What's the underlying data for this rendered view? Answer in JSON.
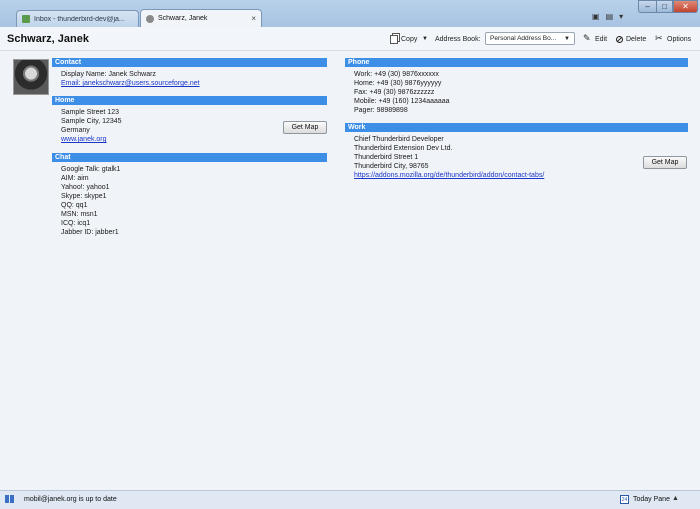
{
  "tabs": [
    {
      "label": "Inbox - thunderbird-dev@ja...",
      "close": ""
    },
    {
      "label": "Schwarz, Janek",
      "close": "×"
    }
  ],
  "window": {
    "minimize": "–",
    "maximize": "□",
    "close": "✕"
  },
  "header": {
    "title": "Schwarz, Janek",
    "copy_label": "Copy",
    "copy_dropdown": "▼",
    "address_book_label": "Address Book:",
    "address_book_value": "Personal Address Bo...",
    "address_book_arrow": "▼",
    "edit_label": "Edit",
    "delete_label": "Delete",
    "options_label": "Options"
  },
  "contact": {
    "heading": "Contact",
    "display_name": "Display Name: Janek Schwarz",
    "email": "Email: janekschwarz@users.sourceforge.net"
  },
  "home": {
    "heading": "Home",
    "street": "Sample Street 123",
    "city": "Sample City, 12345",
    "country": "Germany",
    "website": "www.janek.org",
    "map_button": "Get Map"
  },
  "chat": {
    "heading": "Chat",
    "items": [
      "Google Talk: gtalk1",
      "AIM: aim",
      "Yahoo!: yahoo1",
      "Skype: skype1",
      "QQ: qq1",
      "MSN: msn1",
      "ICQ: icq1",
      "Jabber ID: jabber1"
    ]
  },
  "phone": {
    "heading": "Phone",
    "items": [
      "Work: +49 (30) 9876xxxxxx",
      "Home: +49 (30) 9876yyyyyy",
      "Fax: +49 (30) 9876zzzzzz",
      "Mobile: +49 (160) 1234aaaaaa",
      "Pager: 98989898"
    ]
  },
  "work": {
    "heading": "Work",
    "job_title": "Chief Thunderbird Developer",
    "company": "Thunderbird Extension Dev Ltd.",
    "street": "Thunderbird Street 1",
    "city": "Thunderbird City, 98765",
    "website": "https://addons.mozilla.org/de/thunderbird/addon/contact-tabs/",
    "map_button": "Get Map"
  },
  "status": {
    "text": "mobil@janek.org is up to date",
    "today_pane": "Today Pane",
    "today_day": "24",
    "today_arrow": "▲"
  },
  "colors": {
    "section_header": "#3d8ee6",
    "link": "#1a36c8",
    "close_button": "#c2432d"
  }
}
